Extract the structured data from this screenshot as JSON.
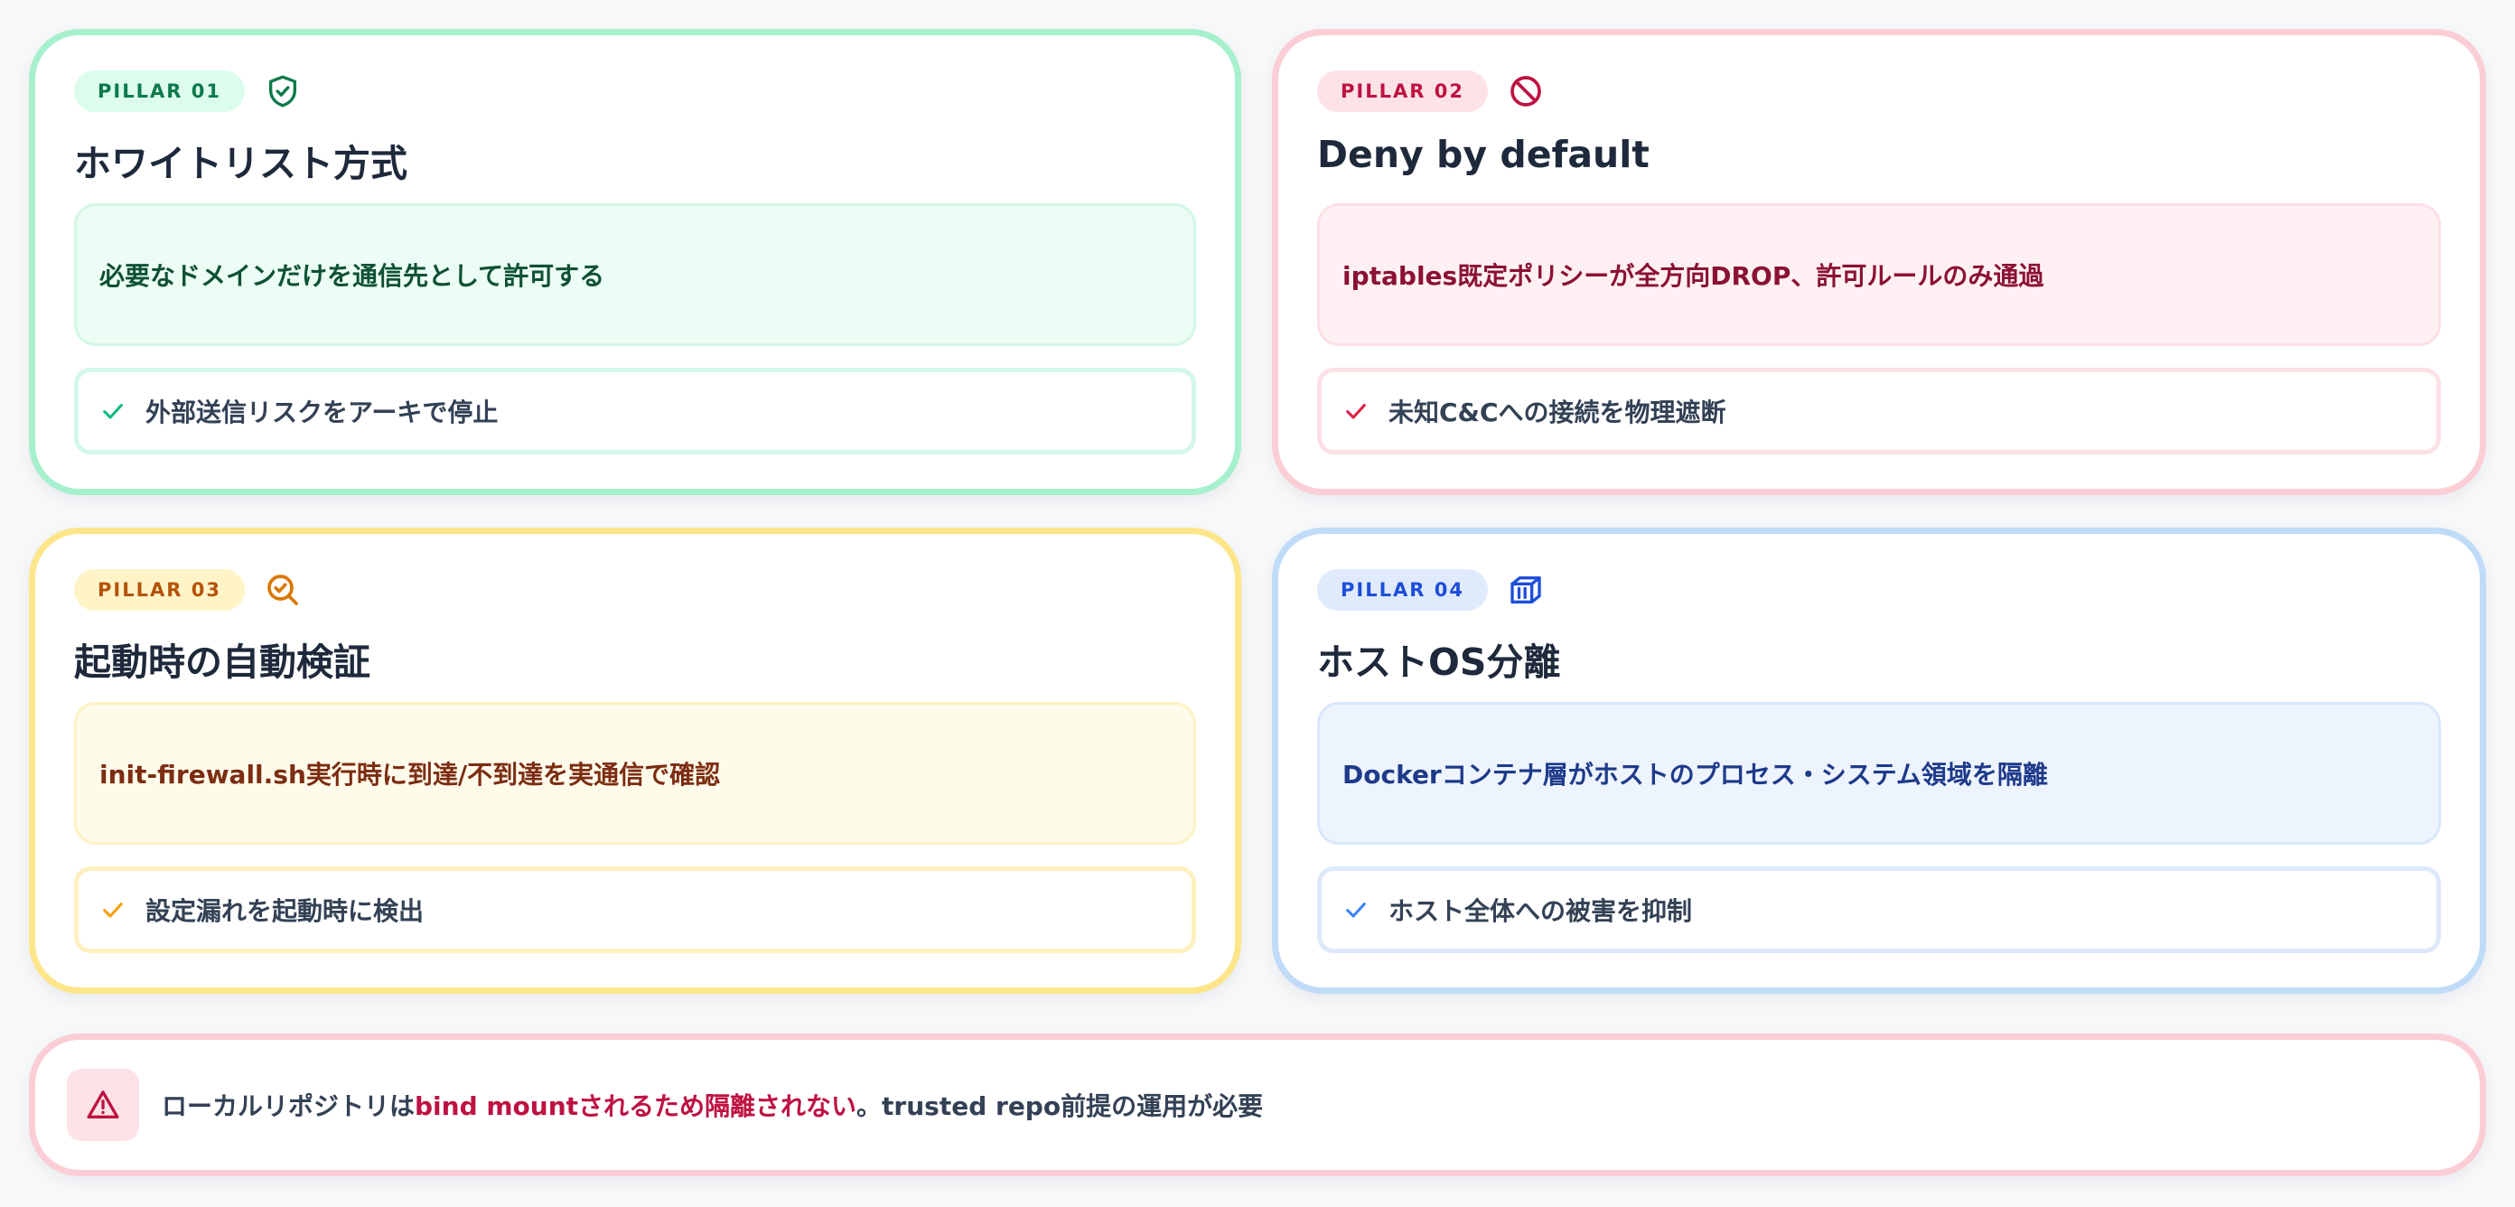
{
  "pillars": [
    {
      "badge": "PILLAR 01",
      "icon": "shield-check-icon",
      "title": "ホワイトリスト方式",
      "description": "必要なドメインだけを通信先として許可する",
      "bullet": "外部送信リスクをアーキで停止",
      "accent": "#0b7a4b"
    },
    {
      "badge": "PILLAR 02",
      "icon": "ban-icon",
      "title": "Deny by default",
      "description": "iptables既定ポリシーが全方向DROP、許可ルールのみ通過",
      "bullet": "未知C&Cへの接続を物理遮断",
      "accent": "#be1241"
    },
    {
      "badge": "PILLAR 03",
      "icon": "search-check-icon",
      "title": "起動時の自動検証",
      "description": "init-firewall.sh実行時に到達/不到達を実通信で確認",
      "bullet": "設定漏れを起動時に検出",
      "accent": "#b45309"
    },
    {
      "badge": "PILLAR 04",
      "icon": "container-icon",
      "title": "ホストOS分離",
      "description": "Dockerコンテナ層がホストのプロセス・システム領域を隔離",
      "bullet": "ホスト全体への被害を抑制",
      "accent": "#1d4ed8"
    }
  ],
  "warning": {
    "icon": "warning-triangle-icon",
    "text_before": "ローカルリポジトリは",
    "text_highlight": "bind mountされるため隔離されない",
    "text_after": "。trusted repo前提の運用が必要",
    "accent": "#be1241"
  }
}
